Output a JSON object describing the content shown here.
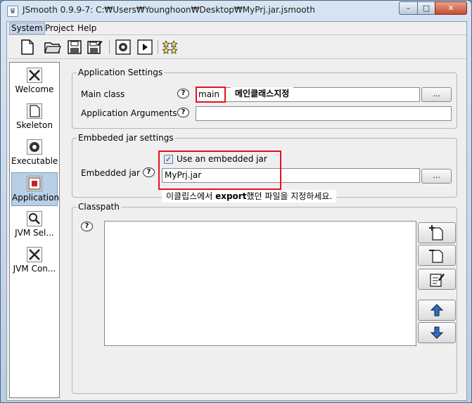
{
  "window": {
    "title": "JSmooth 0.9.9-7: C:₩Users₩Younghoon₩Desktop₩MyPrj.jar.jsmooth",
    "minimize_glyph": "–",
    "maximize_glyph": "□",
    "close_glyph": "✕"
  },
  "menu": {
    "items": [
      {
        "label": "System"
      },
      {
        "label": "Project"
      },
      {
        "label": "Help"
      }
    ]
  },
  "toolbar": {
    "icons": [
      "new-file-icon",
      "open-folder-icon",
      "save-icon",
      "save-as-icon",
      "compile-icon",
      "run-icon",
      "stars-icon"
    ]
  },
  "nav": {
    "items": [
      {
        "label": "Welcome",
        "icon": "welcome-icon"
      },
      {
        "label": "Skeleton",
        "icon": "skeleton-icon"
      },
      {
        "label": "Executable",
        "icon": "executable-icon"
      },
      {
        "label": "Application",
        "icon": "application-icon",
        "selected": true
      },
      {
        "label": "JVM Sel...",
        "icon": "jvm-selection-icon"
      },
      {
        "label": "JVM Con...",
        "icon": "jvm-configuration-icon"
      }
    ]
  },
  "app_settings": {
    "group_title": "Application Settings",
    "main_class_label": "Main class",
    "main_class_value": "main",
    "main_class_note": "메인클래스지정",
    "args_label": "Application Arguments",
    "args_value": "",
    "browse_label": "..."
  },
  "embedded": {
    "group_title": "Embbeded jar settings",
    "jar_label": "Embedded jar",
    "checkbox_label": "Use an embedded jar",
    "checkbox_checked": true,
    "jar_value": "MyPrj.jar",
    "browse_label": "...",
    "note_prefix": "이클립스에서 ",
    "note_bold": "export",
    "note_suffix": "했던 파일을 지정하세요."
  },
  "classpath": {
    "group_title": "Classpath",
    "entries": []
  },
  "help_icon_glyph": "?",
  "colors": {
    "highlight_red": "#e81020",
    "selection_blue": "#b8cfe5"
  }
}
